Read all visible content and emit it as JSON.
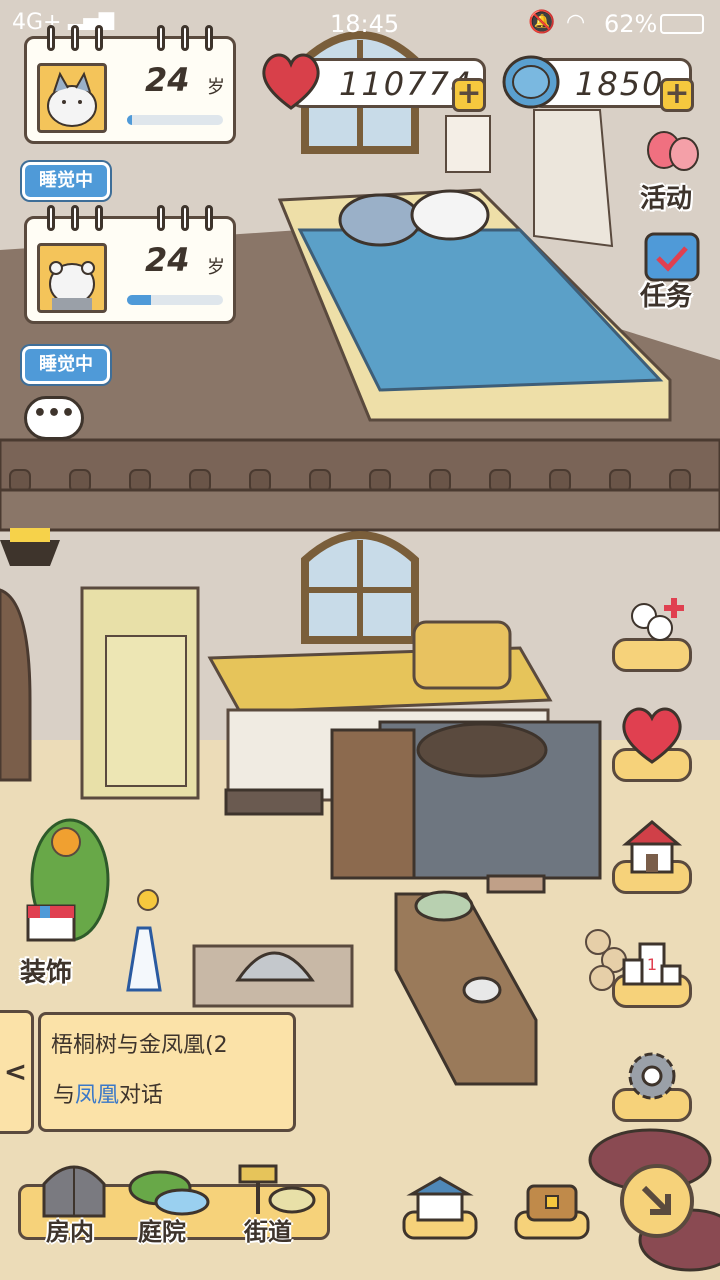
{
  "status_bar": {
    "network": "4G+",
    "time": "18:45",
    "battery": "62%"
  },
  "cats": [
    {
      "age": "24",
      "unit": "岁",
      "status": "睡觉中",
      "progress": 0.05,
      "avatar_color": "#f4c45a"
    },
    {
      "age": "24",
      "unit": "岁",
      "status": "睡觉中",
      "progress": 0.25,
      "avatar_color": "#f4c45a"
    }
  ],
  "currency": {
    "hearts": "110774",
    "coins": "1850"
  },
  "side_menu": {
    "activity_label": "活动",
    "tasks_label": "任务",
    "decorate_label": "装饰"
  },
  "right_menu": {
    "items": [
      "add-cat-icon",
      "heart-icon",
      "house-icon",
      "ranking-icon",
      "gear-icon"
    ]
  },
  "quest": {
    "title": "梧桐树与金凤凰(2",
    "sub_prefix": "与",
    "sub_highlight": "凤凰",
    "sub_suffix": "对话",
    "tab_arrow": "<"
  },
  "bottom_nav": {
    "room_label": "房内",
    "yard_label": "庭院",
    "street_label": "街道"
  },
  "colors": {
    "accent_blue": "#4f9ad8",
    "outline": "#5a4a3e",
    "gold": "#f6c83e"
  }
}
